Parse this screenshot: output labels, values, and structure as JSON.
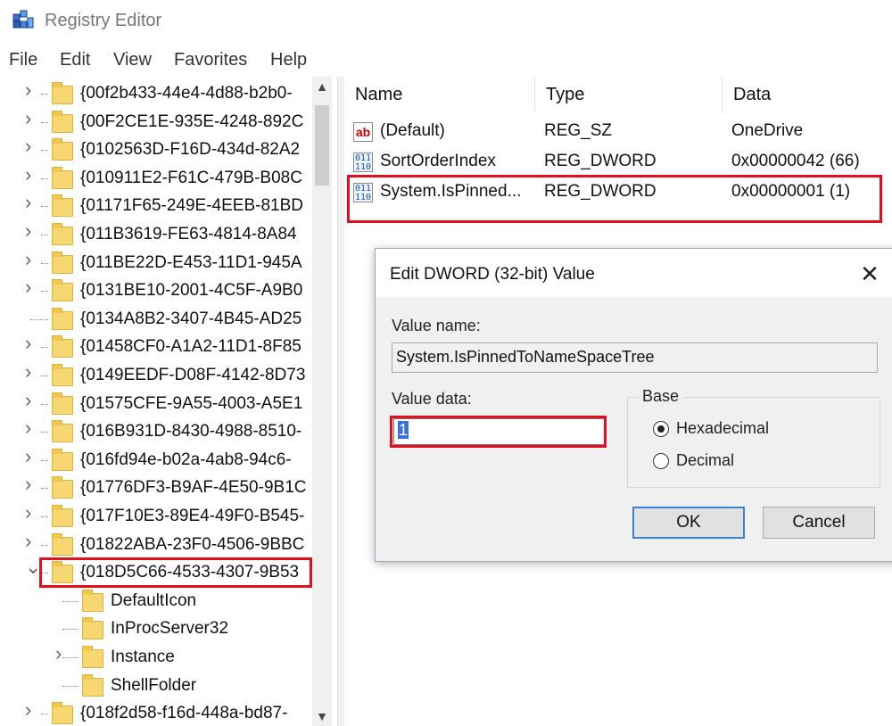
{
  "window": {
    "title": "Registry Editor"
  },
  "menu": [
    "File",
    "Edit",
    "View",
    "Favorites",
    "Help"
  ],
  "tree": {
    "items": [
      {
        "label": "{00f2b433-44e4-4d88-b2b0-",
        "level": 0,
        "expander": "right"
      },
      {
        "label": "{00F2CE1E-935E-4248-892C",
        "level": 0,
        "expander": "right"
      },
      {
        "label": "{0102563D-F16D-434d-82A2",
        "level": 0,
        "expander": "right"
      },
      {
        "label": "{010911E2-F61C-479B-B08C",
        "level": 0,
        "expander": "right"
      },
      {
        "label": "{01171F65-249E-4EEB-81BD",
        "level": 0,
        "expander": "right"
      },
      {
        "label": "{011B3619-FE63-4814-8A84",
        "level": 0,
        "expander": "right"
      },
      {
        "label": "{011BE22D-E453-11D1-945A",
        "level": 0,
        "expander": "right"
      },
      {
        "label": "{0131BE10-2001-4C5F-A9B0",
        "level": 0,
        "expander": "right"
      },
      {
        "label": "{0134A8B2-3407-4B45-AD25",
        "level": 0,
        "expander": "none"
      },
      {
        "label": "{01458CF0-A1A2-11D1-8F85",
        "level": 0,
        "expander": "right"
      },
      {
        "label": "{0149EEDF-D08F-4142-8D73",
        "level": 0,
        "expander": "right"
      },
      {
        "label": "{01575CFE-9A55-4003-A5E1",
        "level": 0,
        "expander": "right"
      },
      {
        "label": "{016B931D-8430-4988-8510-",
        "level": 0,
        "expander": "right"
      },
      {
        "label": "{016fd94e-b02a-4ab8-94c6-",
        "level": 0,
        "expander": "right"
      },
      {
        "label": "{01776DF3-B9AF-4E50-9B1C",
        "level": 0,
        "expander": "right"
      },
      {
        "label": "{017F10E3-89E4-49F0-B545-",
        "level": 0,
        "expander": "right"
      },
      {
        "label": "{01822ABA-23F0-4506-9BBC",
        "level": 0,
        "expander": "right"
      },
      {
        "label": "{018D5C66-4533-4307-9B53",
        "level": 0,
        "expander": "down"
      },
      {
        "label": "DefaultIcon",
        "level": 1,
        "expander": "none"
      },
      {
        "label": "InProcServer32",
        "level": 1,
        "expander": "none"
      },
      {
        "label": "Instance",
        "level": 1,
        "expander": "right"
      },
      {
        "label": "ShellFolder",
        "level": 1,
        "expander": "none"
      },
      {
        "label": "{018f2d58-f16d-448a-bd87-",
        "level": 0,
        "expander": "right"
      }
    ]
  },
  "list": {
    "columns": [
      "Name",
      "Type",
      "Data"
    ],
    "rows": [
      {
        "icon": "string-value-icon",
        "name": "(Default)",
        "type": "REG_SZ",
        "data": "OneDrive"
      },
      {
        "icon": "binary-value-icon",
        "name": "SortOrderIndex",
        "type": "REG_DWORD",
        "data": "0x00000042 (66)"
      },
      {
        "icon": "binary-value-icon",
        "name": "System.IsPinned...",
        "type": "REG_DWORD",
        "data": "0x00000001 (1)"
      }
    ]
  },
  "dialog": {
    "title": "Edit DWORD (32-bit) Value",
    "close_glyph": "✕",
    "value_name_label": "Value name:",
    "value_name": "System.IsPinnedToNameSpaceTree",
    "value_data_label": "Value data:",
    "value_data": "1",
    "base_label": "Base",
    "base_options": [
      "Hexadecimal",
      "Decimal"
    ],
    "base_selected": "Hexadecimal",
    "ok_label": "OK",
    "cancel_label": "Cancel"
  },
  "colors": {
    "highlight_box": "#e0101e",
    "folder": "#f6d772",
    "selection": "#3874d8"
  }
}
